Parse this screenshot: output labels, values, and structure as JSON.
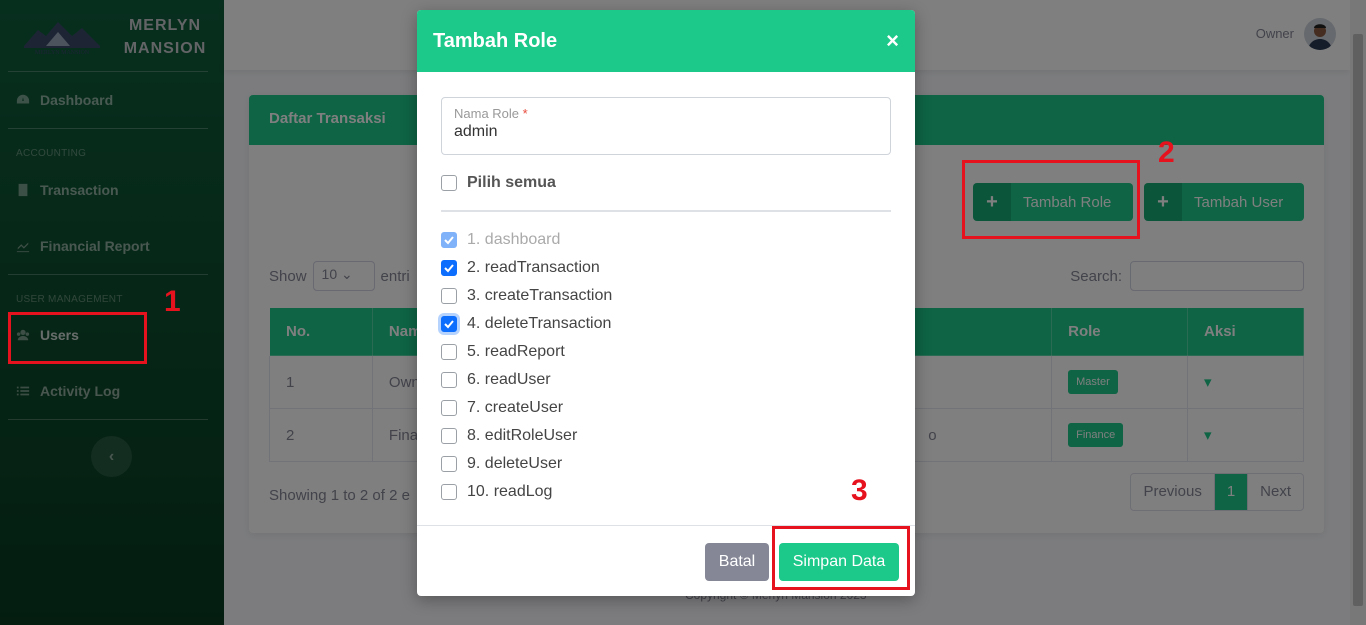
{
  "brand": {
    "name_line1": "MERLYN",
    "name_line2": "MANSION",
    "logo_text": "MERLYN MANSION"
  },
  "sidebar": {
    "items": [
      {
        "label": "Dashboard",
        "icon": "dashboard-icon"
      },
      {
        "heading": "ACCOUNTING"
      },
      {
        "label": "Transaction",
        "icon": "book-icon"
      },
      {
        "label": "Financial Report",
        "icon": "chart-icon"
      },
      {
        "heading": "USER MANAGEMENT"
      },
      {
        "label": "Users",
        "icon": "users-icon"
      },
      {
        "label": "Activity Log",
        "icon": "list-icon"
      }
    ],
    "toggle_icon": "‹"
  },
  "topbar": {
    "user_name": "Owner"
  },
  "card": {
    "title": "Daftar Transaksi",
    "btn_add_role": "Tambah Role",
    "btn_add_user": "Tambah User",
    "show_label": "Show",
    "show_value": "10",
    "entries_label": "entri",
    "search_label": "Search:",
    "columns": [
      "No.",
      "Nam",
      "",
      "Role",
      "Aksi"
    ],
    "rows": [
      {
        "no": "1",
        "name": "Own",
        "role": "Master"
      },
      {
        "no": "2",
        "name": "Fina",
        "extra": "o",
        "role": "Finance"
      }
    ],
    "showing": "Showing 1 to 2 of 2 e",
    "pager": {
      "prev": "Previous",
      "page": "1",
      "next": "Next"
    }
  },
  "copyright": "Copyright © Merlyn Mansion 2023",
  "annotations": {
    "one": "1",
    "two": "2",
    "three": "3"
  },
  "modal": {
    "title": "Tambah Role",
    "close": "×",
    "field_label": "Nama Role",
    "field_required": "*",
    "field_value": "admin",
    "select_all": "Pilih semua",
    "permissions": [
      {
        "label": "1. dashboard",
        "checked": true,
        "disabled": true
      },
      {
        "label": "2. readTransaction",
        "checked": true
      },
      {
        "label": "3. createTransaction",
        "checked": false
      },
      {
        "label": "4. deleteTransaction",
        "checked": true,
        "focus": true
      },
      {
        "label": "5. readReport",
        "checked": false
      },
      {
        "label": "6. readUser",
        "checked": false
      },
      {
        "label": "7. createUser",
        "checked": false
      },
      {
        "label": "8. editRoleUser",
        "checked": false
      },
      {
        "label": "9. deleteUser",
        "checked": false
      },
      {
        "label": "10. readLog",
        "checked": false
      }
    ],
    "btn_cancel": "Batal",
    "btn_save": "Simpan Data"
  },
  "colors": {
    "accent": "#1cc88a",
    "annotation": "#e6121e",
    "checkbox": "#0d6efd"
  }
}
